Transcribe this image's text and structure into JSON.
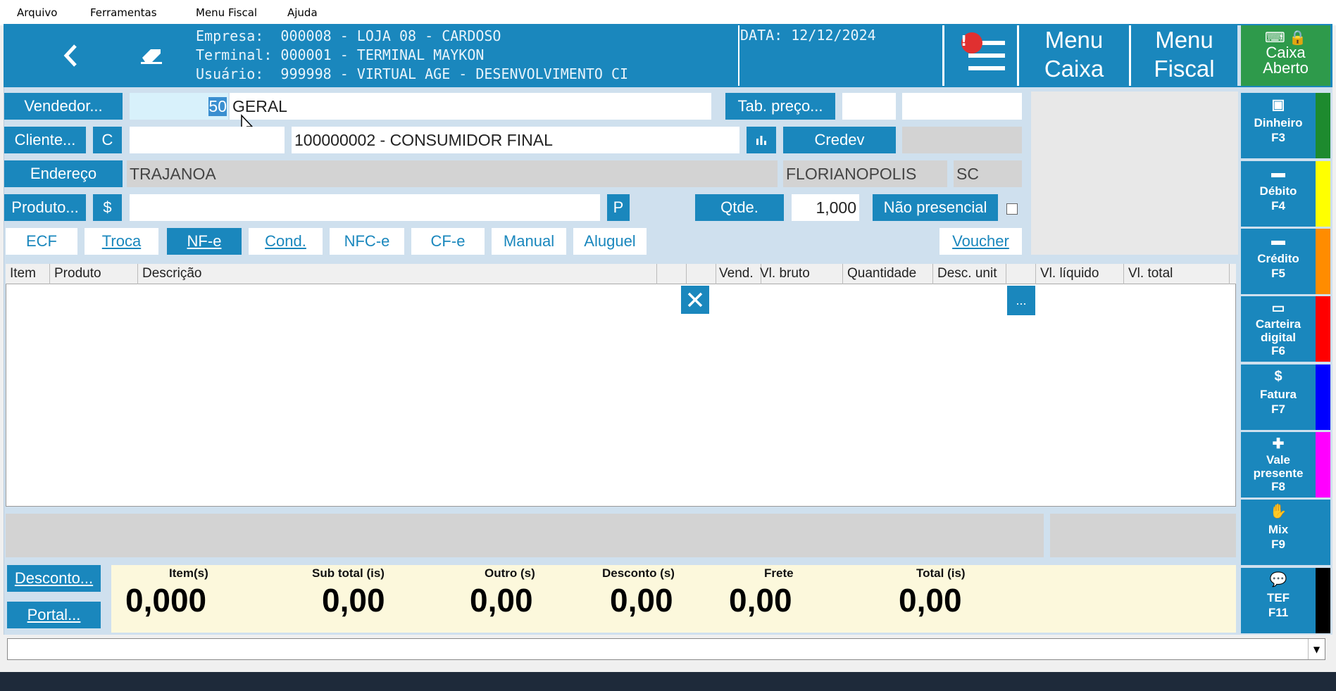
{
  "menu": {
    "arquivo": "Arquivo",
    "ferramentas": "Ferramentas",
    "menu_fiscal": "Menu Fiscal",
    "ajuda": "Ajuda"
  },
  "header": {
    "empresa_line": "Empresa:  000008 - LOJA 08 - CARDOSO",
    "terminal_line": "Terminal: 000001 - TERMINAL MAYKON",
    "usuario_line": "Usuário:  999998 - VIRTUAL AGE - DESENVOLVIMENTO CI",
    "data_line": "DATA: 12/12/2024",
    "alert_badge": "!",
    "menu_caixa_1": "Menu",
    "menu_caixa_2": "Caixa",
    "menu_fiscal_1": "Menu",
    "menu_fiscal_2": "Fiscal",
    "caixa_1": "Caixa",
    "caixa_2": "Aberto"
  },
  "form": {
    "vendedor_label": "Vendedor...",
    "vendedor_code": "50",
    "vendedor_name": "GERAL",
    "tab_preco_label": "Tab. preço...",
    "cliente_label": "Cliente...",
    "cliente_c": "C",
    "cliente_name": "100000002 - CONSUMIDOR FINAL",
    "credev_label": "Credev",
    "endereco_label": "Endereço",
    "endereco_value": "TRAJANOA",
    "cidade_value": "FLORIANOPOLIS",
    "uf_value": "SC",
    "produto_label": "Produto...",
    "produto_dollar": "$",
    "produto_p": "P",
    "qtde_label": "Qtde.",
    "qtde_value": "1,000",
    "nao_presencial_label": "Não presencial"
  },
  "tabs": {
    "ecf": "ECF",
    "troca": "Troca",
    "nfe": "NF-e",
    "cond": "Cond.",
    "nfce": "NFC-e",
    "cfe": "CF-e",
    "manual": "Manual",
    "aluguel": "Aluguel",
    "voucher": "Voucher"
  },
  "grid": {
    "col_item": "Item",
    "col_produto": "Produto",
    "col_descricao": "Descrição",
    "col_vend": "Vend.",
    "col_vl_bruto": "Vl. bruto",
    "col_quantidade": "Quantidade",
    "col_desc_unit": "Desc. unit",
    "col_vl_liquido": "Vl. líquido",
    "col_vl_total": "Vl. total",
    "more_label": "..."
  },
  "payments": {
    "dinheiro_1": "Dinheiro",
    "dinheiro_2": "F3",
    "debito_1": "Débito",
    "debito_2": "F4",
    "credito_1": "Crédito",
    "credito_2": "F5",
    "carteira_1": "Carteira",
    "carteira_2": "digital",
    "carteira_3": "F6",
    "fatura_1": "Fatura",
    "fatura_2": "F7",
    "vale_1": "Vale",
    "vale_2": "presente",
    "vale_3": "F8",
    "mix_1": "Mix",
    "mix_2": "F9",
    "tef_1": "TEF",
    "tef_2": "F11"
  },
  "colors": {
    "dinheiro": "#1d8a2e",
    "debito": "#ffff00",
    "credito": "#ff8c00",
    "carteira": "#ff0000",
    "fatura": "#0000ff",
    "vale": "#ff00ff",
    "mix": "#1a87bd",
    "tef": "#000000"
  },
  "footer": {
    "desconto_label": "Desconto...",
    "portal_label": "Portal...",
    "items_label": "Item(s)",
    "items_value": "0,000",
    "subtotal_label": "Sub total (is)",
    "subtotal_value": "0,00",
    "outro_label": "Outro (s)",
    "outro_value": "0,00",
    "desconto_total_label": "Desconto (s)",
    "desconto_total_value": "0,00",
    "frete_label": "Frete",
    "frete_value": "0,00",
    "total_label": "Total (is)",
    "total_value": "0,00"
  }
}
